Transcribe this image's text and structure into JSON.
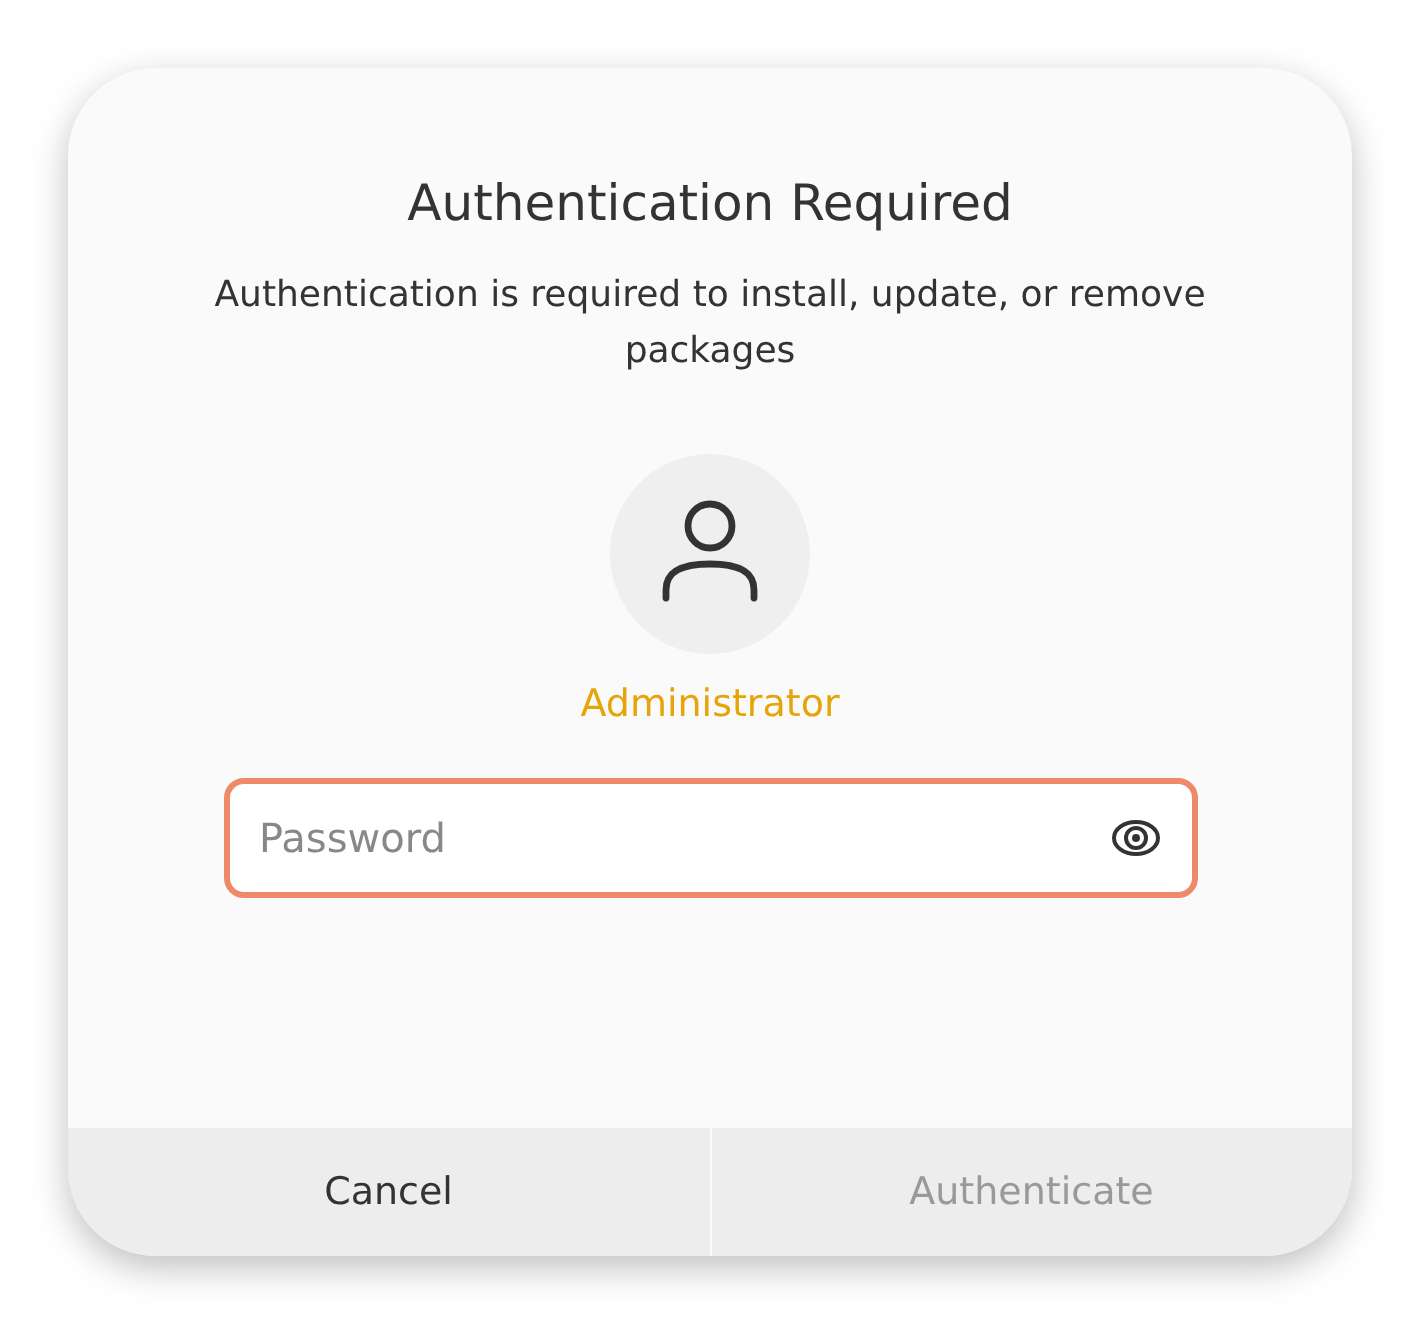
{
  "dialog": {
    "title": "Authentication Required",
    "message": "Authentication is required to install, update, or remove packages"
  },
  "user": {
    "name": "Administrator"
  },
  "password_field": {
    "placeholder": "Password",
    "focused": true
  },
  "buttons": [
    {
      "label": "Cancel",
      "disabled": false
    },
    {
      "label": "Authenticate",
      "disabled": true
    }
  ]
}
